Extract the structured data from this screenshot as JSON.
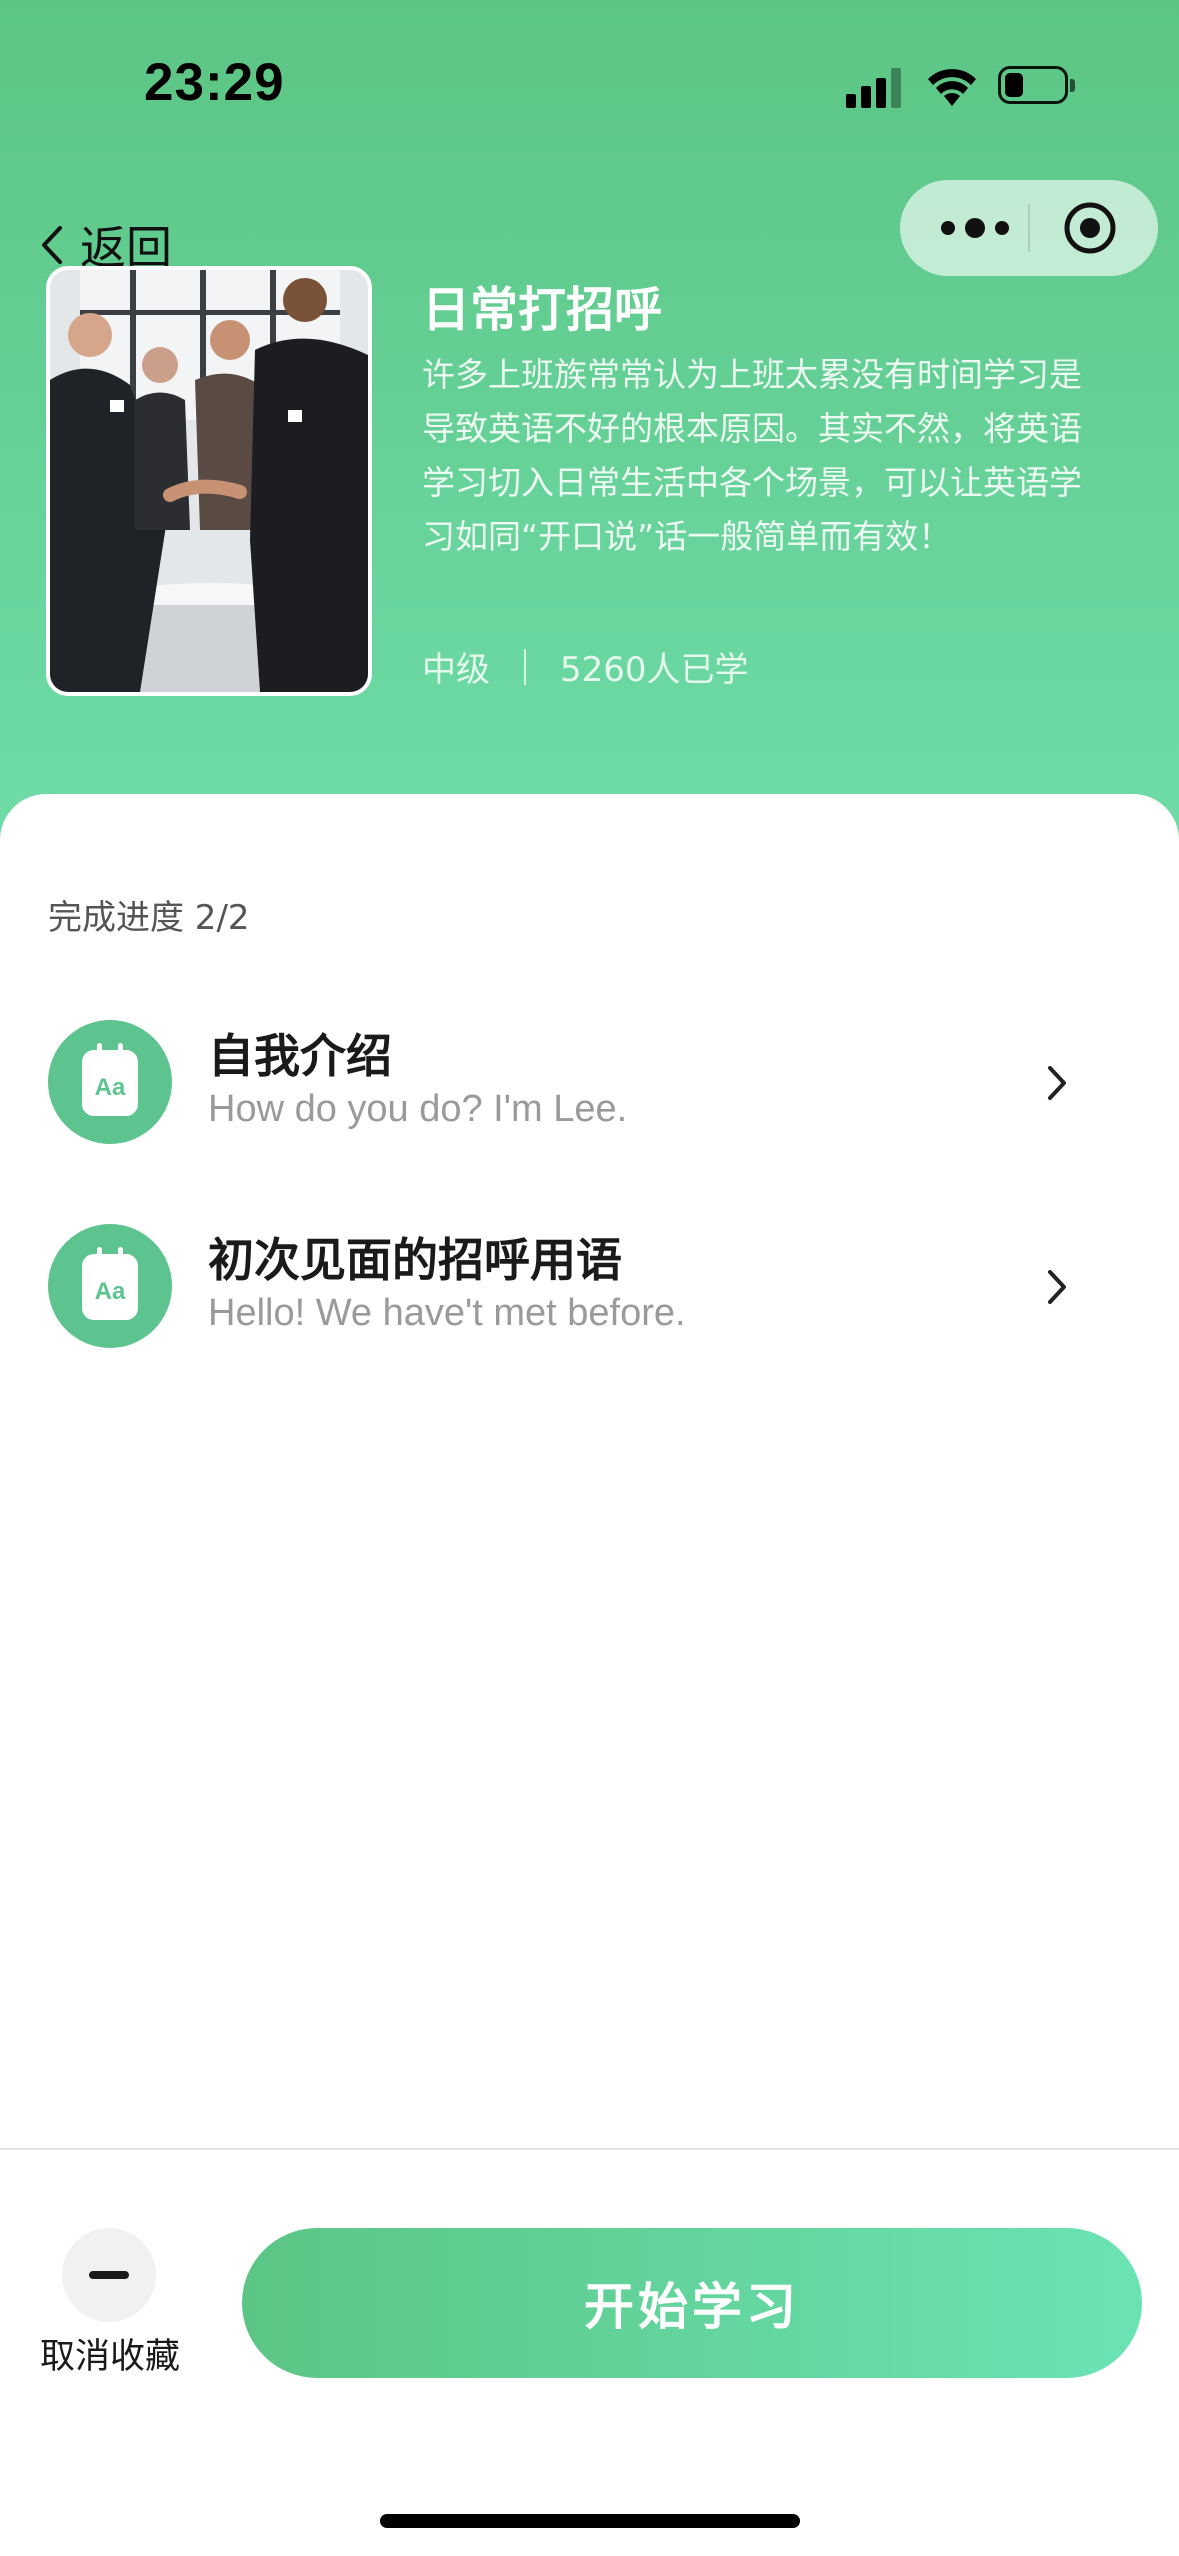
{
  "status_bar": {
    "time": "23:29"
  },
  "nav": {
    "back_label": "返回"
  },
  "course": {
    "title": "日常打招呼",
    "description": "许多上班族常常认为上班太累没有时间学习是导致英语不好的根本原因。其实不然，将英语学习切入日常生活中各个场景，可以让英语学习如同“开口说”话一般简单而有效！",
    "level": "中级",
    "learners": "5260人已学"
  },
  "progress": {
    "label": "完成进度 2/2"
  },
  "lessons": [
    {
      "title_zh": "自我介绍",
      "title_en": "How do you do? I'm Lee.",
      "icon": "flashcard-icon"
    },
    {
      "title_zh": "初次见面的招呼用语",
      "title_en": "Hello! We have't met before.",
      "icon": "flashcard-icon"
    }
  ],
  "icon_text": "Aa",
  "bottom_bar": {
    "favorite_label": "取消收藏",
    "start_label": "开始学习"
  },
  "colors": {
    "header_top": "#5cc585",
    "header_bottom": "#6fdca8",
    "accent": "#5ec48f"
  }
}
